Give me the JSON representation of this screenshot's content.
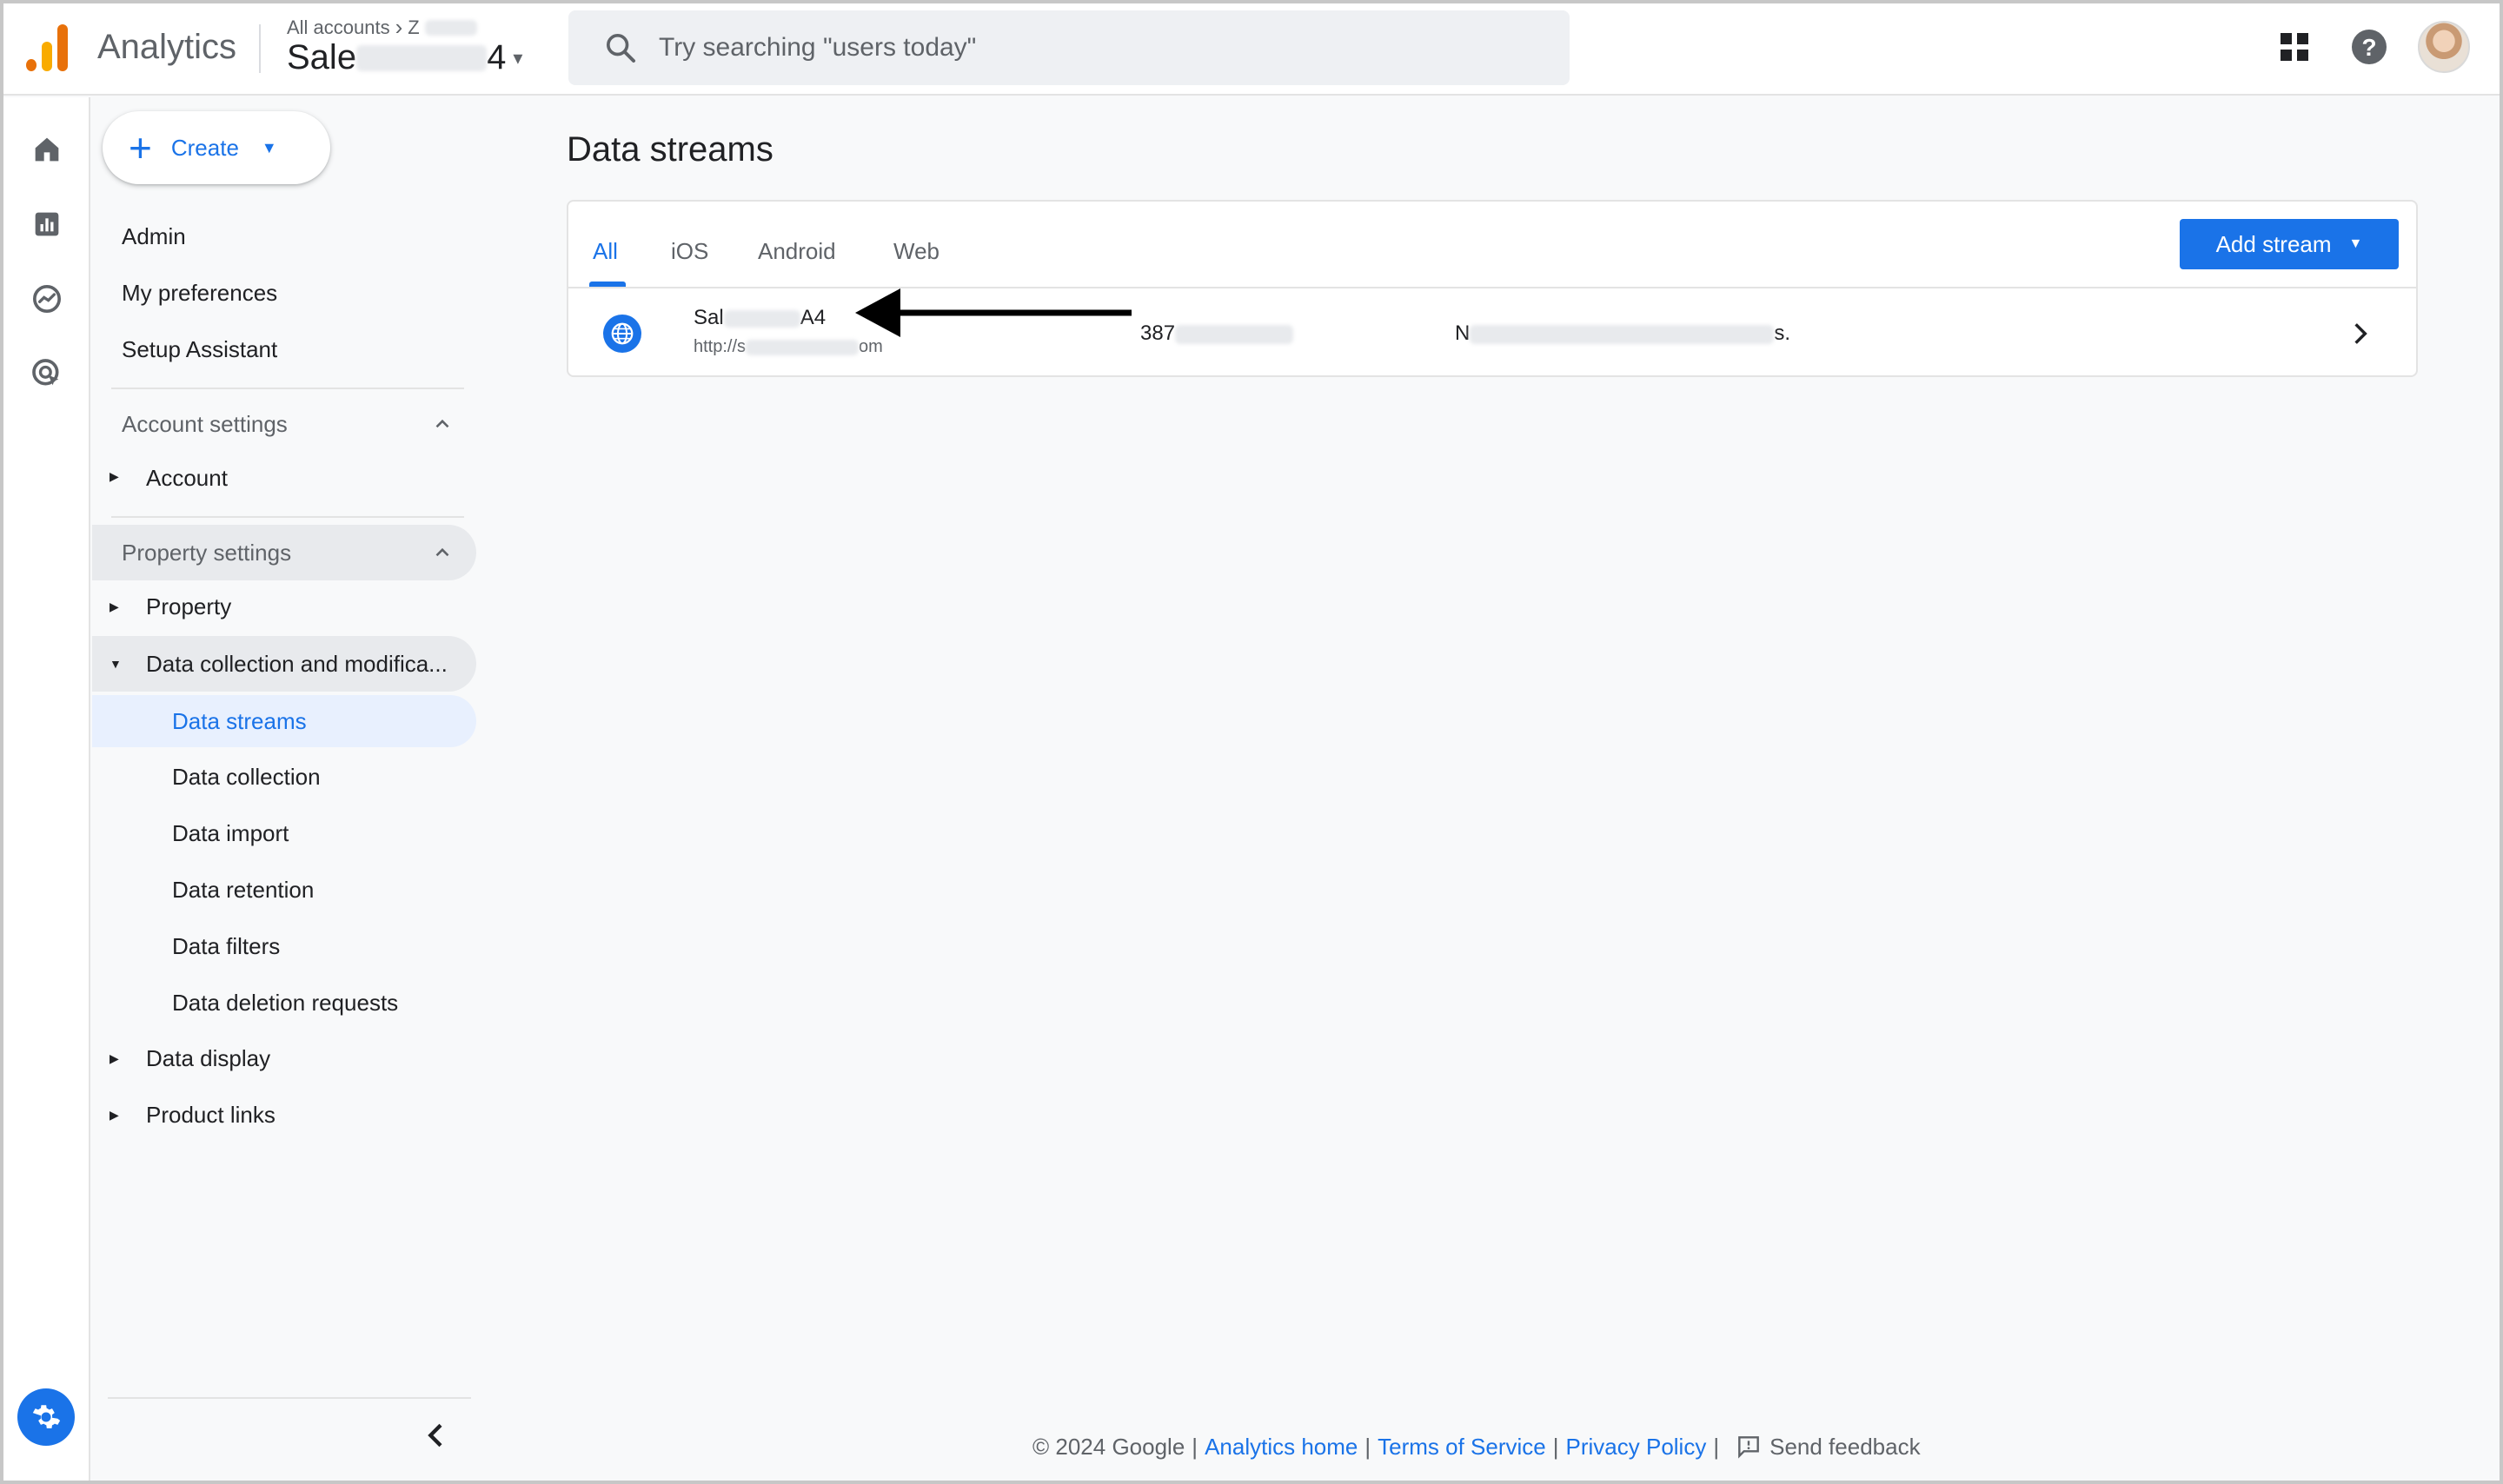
{
  "header": {
    "app_title": "Analytics",
    "breadcrumb_root": "All accounts",
    "breadcrumb_account_visible": "Z",
    "property_prefix": "Sale",
    "property_suffix": "4",
    "search_placeholder": "Try searching \"users today\""
  },
  "nav": {
    "create_label": "Create",
    "top_items": [
      "Admin",
      "My preferences",
      "Setup Assistant"
    ],
    "account_settings_label": "Account settings",
    "account_item": "Account",
    "property_settings_label": "Property settings",
    "property_item": "Property",
    "data_collection_item": "Data collection and modifica...",
    "sub_items": [
      "Data streams",
      "Data collection",
      "Data import",
      "Data retention",
      "Data filters",
      "Data deletion requests"
    ],
    "data_display_item": "Data display",
    "product_links_item": "Product links"
  },
  "main": {
    "page_title": "Data streams",
    "tabs": [
      "All",
      "iOS",
      "Android",
      "Web"
    ],
    "add_stream_label": "Add stream",
    "stream": {
      "name_prefix": "Sal",
      "name_suffix": "A4",
      "url_prefix": "http://s",
      "url_suffix": "om",
      "id_prefix": "387",
      "status_prefix": "N",
      "status_suffix": "s."
    }
  },
  "footer": {
    "copyright": "© 2024 Google",
    "analytics_home": "Analytics home",
    "terms": "Terms of Service",
    "privacy": "Privacy Policy",
    "feedback": "Send feedback"
  },
  "colors": {
    "accent": "#1a73e8",
    "logo_orange": "#e8710a",
    "logo_yellow": "#f9ab00",
    "selected_bg": "#e8f0fe"
  }
}
